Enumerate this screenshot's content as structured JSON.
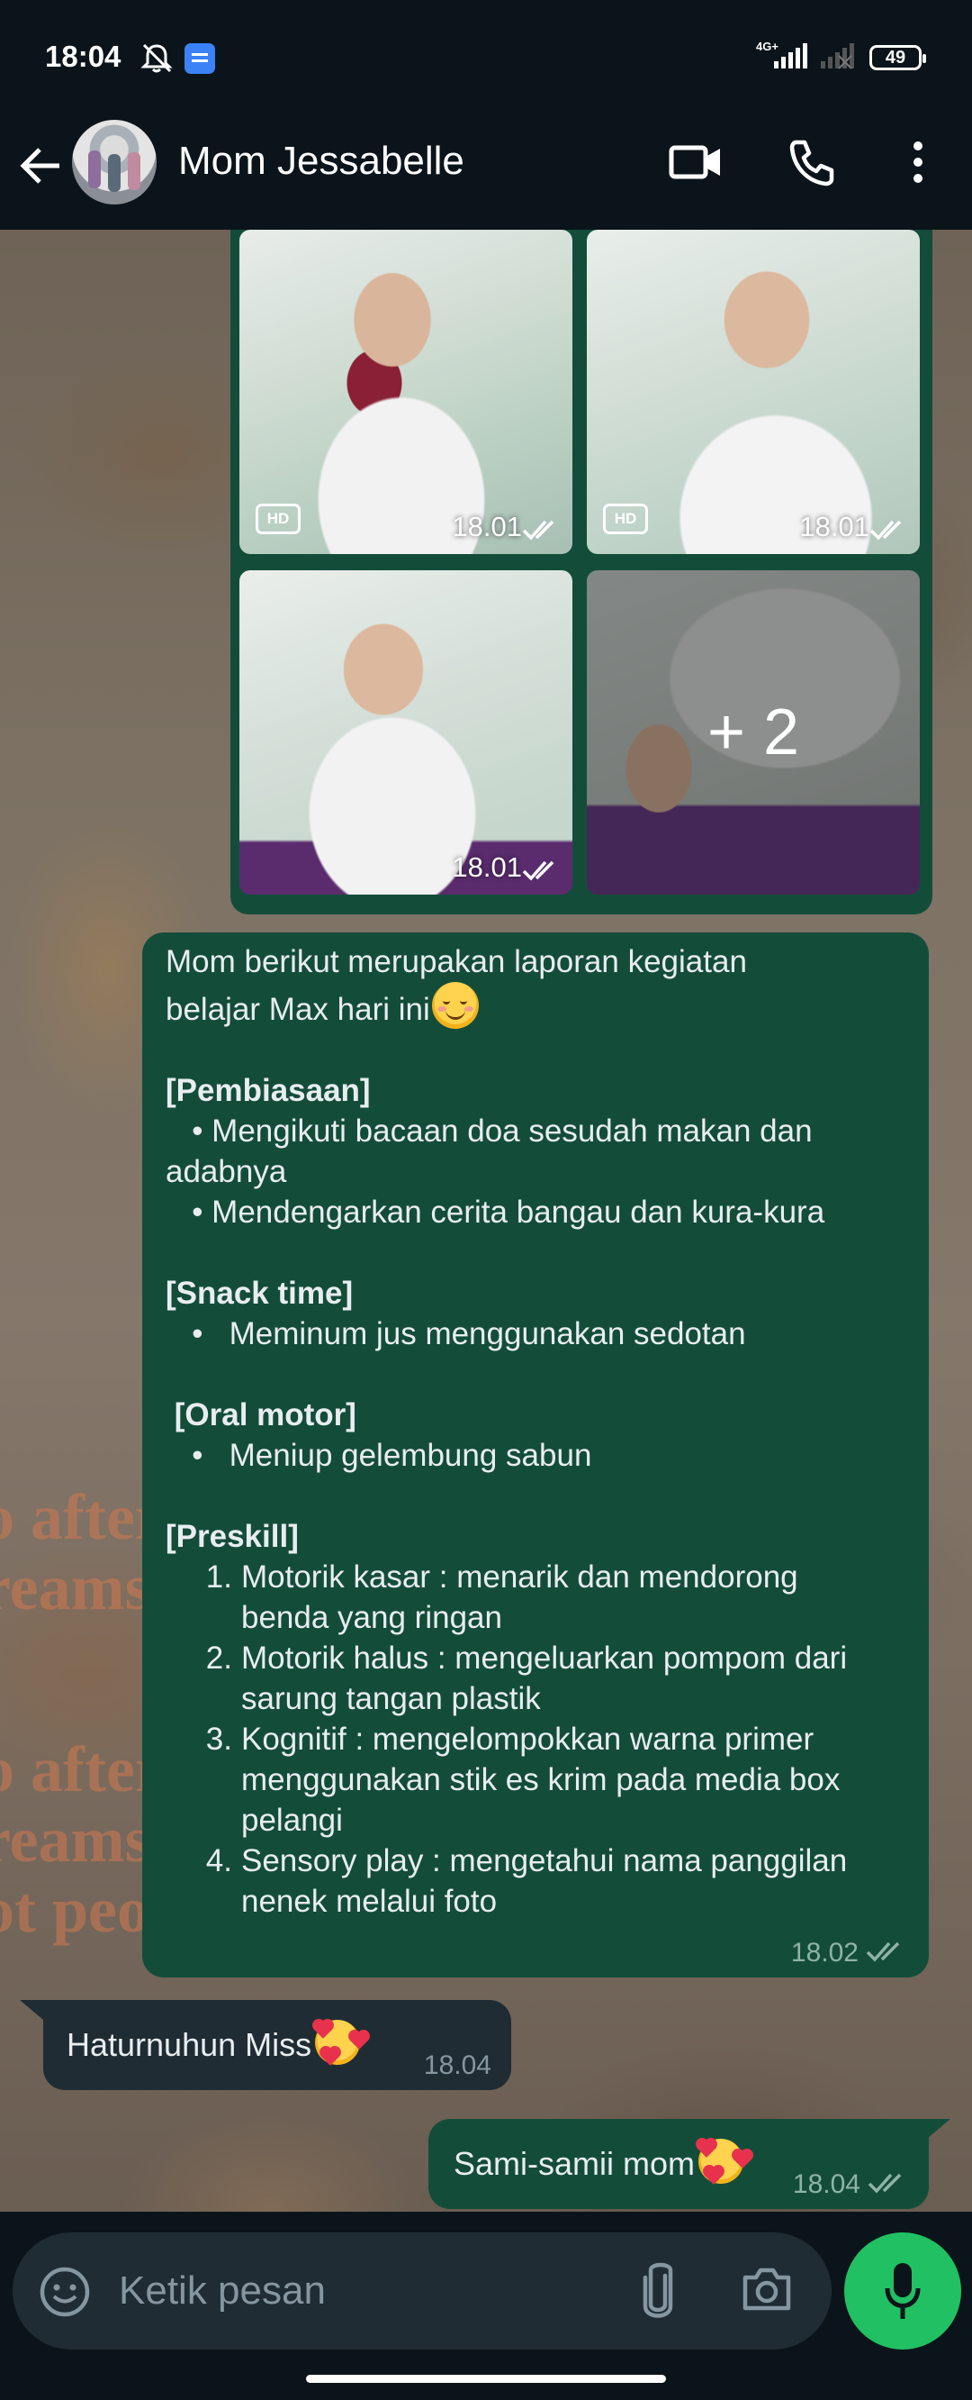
{
  "status_bar": {
    "time": "18:04",
    "network": "4G+",
    "battery": "49"
  },
  "header": {
    "contact_name": "Mom Jessabelle"
  },
  "album": {
    "photos": [
      {
        "badge": "HD",
        "time": "18.01"
      },
      {
        "badge": "HD",
        "time": "18.01"
      },
      {
        "badge": "",
        "time": "18.01"
      }
    ],
    "more_count": "+ 2"
  },
  "messages": {
    "report": {
      "intro": "Mom berikut merupakan laporan kegiatan\nbelajar Max hari ini",
      "section1_title": "[Pembiasaan]",
      "section1_body": "   • Mengikuti bacaan doa sesudah makan dan\nadabnya\n   • Mendengarkan cerita bangau dan kura-kura",
      "section2_title": "[Snack time]",
      "section2_body": "   •   Meminum jus menggunakan sedotan",
      "section3_title": " [Oral motor]",
      "section3_body": "   •   Meniup gelembung sabun",
      "section4_title": "[Preskill]",
      "preskill_items": [
        "Motorik kasar : menarik dan mendorong\nbenda yang ringan",
        "Motorik halus : mengeluarkan pompom dari\nsarung tangan plastik",
        "Kognitif : mengelompokkan warna primer\nmenggunakan stik es krim pada media box\npelangi",
        "Sensory play : mengetahui nama panggilan\nnenek melalui foto"
      ],
      "preskill_numbers": [
        "1.",
        "2.",
        "3.",
        "4."
      ],
      "time": "18.02"
    },
    "reply_in": {
      "text": "Haturnuhun Miss",
      "time": "18.04"
    },
    "reply_out": {
      "text": "Sami-samii mom",
      "time": "18.04"
    }
  },
  "input": {
    "placeholder": "Ketik pesan"
  }
}
